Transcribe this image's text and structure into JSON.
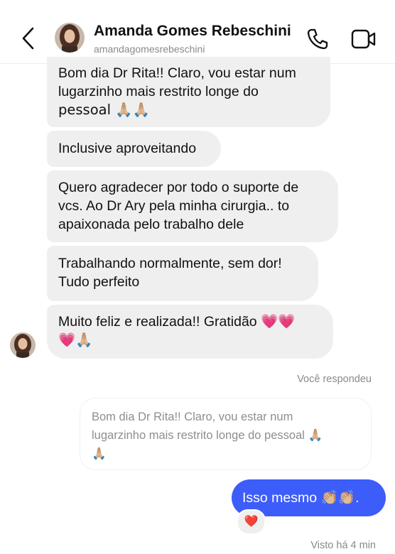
{
  "header": {
    "name": "Amanda Gomes Rebeschini",
    "handle": "amandagomesrebeschini",
    "icons": [
      "back-chevron-icon",
      "avatar",
      "phone-icon",
      "video-icon"
    ]
  },
  "incoming": [
    {
      "lines": [
        "Bom dia Dr Rita!! Claro, vou estar num",
        "lugarzinho mais restrito longe do",
        "pessoal 🙏🏼🙏🏼"
      ]
    },
    {
      "lines": [
        "Inclusive aproveitando"
      ]
    },
    {
      "lines": [
        "Quero agradecer por todo o suporte de",
        "vcs. Ao Dr Ary pela minha cirurgia.. to",
        "apaixonada pelo trabalho dele"
      ]
    },
    {
      "lines": [
        "Trabalhando normalmente, sem dor!",
        "Tudo perfeito"
      ]
    },
    {
      "lines": [
        "Muito feliz e realizada!! Gratidão 💗💗",
        "💗🙏🏼"
      ]
    }
  ],
  "reply_label": "Você respondeu",
  "quoted_lines": [
    "Bom dia Dr Rita!! Claro, vou estar num",
    "lugarzinho mais restrito longe do pessoal 🙏🏼",
    "🙏🏼"
  ],
  "outgoing": {
    "text": "Isso mesmo 👏🏼👏🏼."
  },
  "reaction": "❤️",
  "seen_label": "Visto há 4 min",
  "colors": {
    "outgoing_bubble": "#3c5dfa",
    "incoming_bubble": "#efefef",
    "meta_text": "#8a8a8a"
  }
}
